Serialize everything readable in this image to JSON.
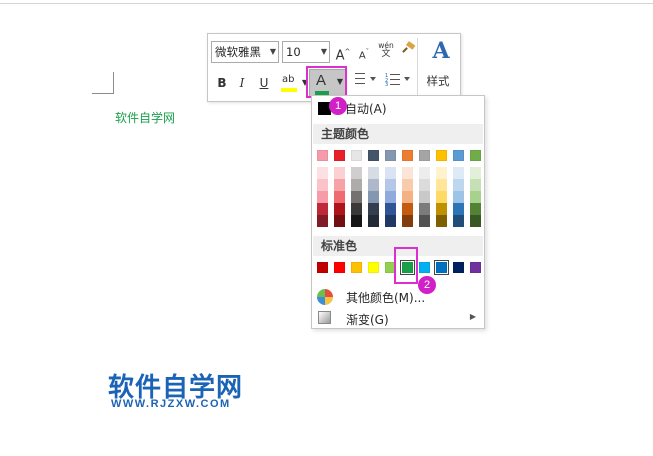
{
  "document": {
    "body_text": "软件自学网"
  },
  "toolbar": {
    "font_name": "微软雅黑",
    "font_size": "10",
    "grow_label": "A",
    "grow_sup": "^",
    "shrink_label": "A",
    "shrink_sup": "ˇ",
    "wen_top": "wén",
    "wen_bottom": "文",
    "bold_label": "B",
    "italic_label": "I",
    "underline_label": "U",
    "highlight_label": "ab",
    "font_color_label": "A",
    "font_color_value": "#1aa04b",
    "highlight_color": "#ffff00",
    "styles_label": "样式",
    "styles_icon": "A"
  },
  "color_menu": {
    "auto_label": "自动(A)",
    "theme_header": "主题颜色",
    "standard_header": "标准色",
    "more_colors_label": "其他颜色(M)...",
    "gradient_label": "渐变(G)",
    "theme_top": [
      "#f79aa9",
      "#e8202a",
      "#e7e6e6",
      "#44546a",
      "#8497b0",
      "#ed7d31",
      "#a5a5a5",
      "#ffc000",
      "#5b9bd5",
      "#70ad47"
    ],
    "theme_shades": [
      [
        "#fde0e3",
        "#fbc2c8",
        "#f79aa9",
        "#c0283a",
        "#801b27"
      ],
      [
        "#fcd0d2",
        "#f6a2a6",
        "#ef6b71",
        "#b0141b",
        "#750e12"
      ],
      [
        "#d0cece",
        "#aeabab",
        "#757171",
        "#3a3838",
        "#171616"
      ],
      [
        "#d6dce4",
        "#adb9ca",
        "#8497b0",
        "#333f4f",
        "#222a35"
      ],
      [
        "#dae3f3",
        "#b4c7e7",
        "#8faadc",
        "#2f5597",
        "#203864"
      ],
      [
        "#fbe5d6",
        "#f8cbad",
        "#f4b183",
        "#c55a11",
        "#843c0c"
      ],
      [
        "#ededed",
        "#dbdbdb",
        "#c9c9c9",
        "#7b7b7b",
        "#525252"
      ],
      [
        "#fff2cc",
        "#ffe699",
        "#ffd966",
        "#bf9000",
        "#7f6000"
      ],
      [
        "#deebf7",
        "#bdd7ee",
        "#9dc3e6",
        "#2e75b6",
        "#1f4e79"
      ],
      [
        "#e2f0d9",
        "#c5e0b4",
        "#a9d18e",
        "#548235",
        "#385723"
      ]
    ],
    "standard": [
      "#c00000",
      "#ff0000",
      "#ffc000",
      "#ffff00",
      "#92d050",
      "#1aa04b",
      "#00b0f0",
      "#0070c0",
      "#002060",
      "#7030a0"
    ],
    "selected_standard_index": 5,
    "hover_standard_index": 7
  },
  "badges": {
    "step1": "1",
    "step2": "2"
  },
  "logo": {
    "main": "软件自学网",
    "sub": "WWW.RJZXW.COM"
  }
}
